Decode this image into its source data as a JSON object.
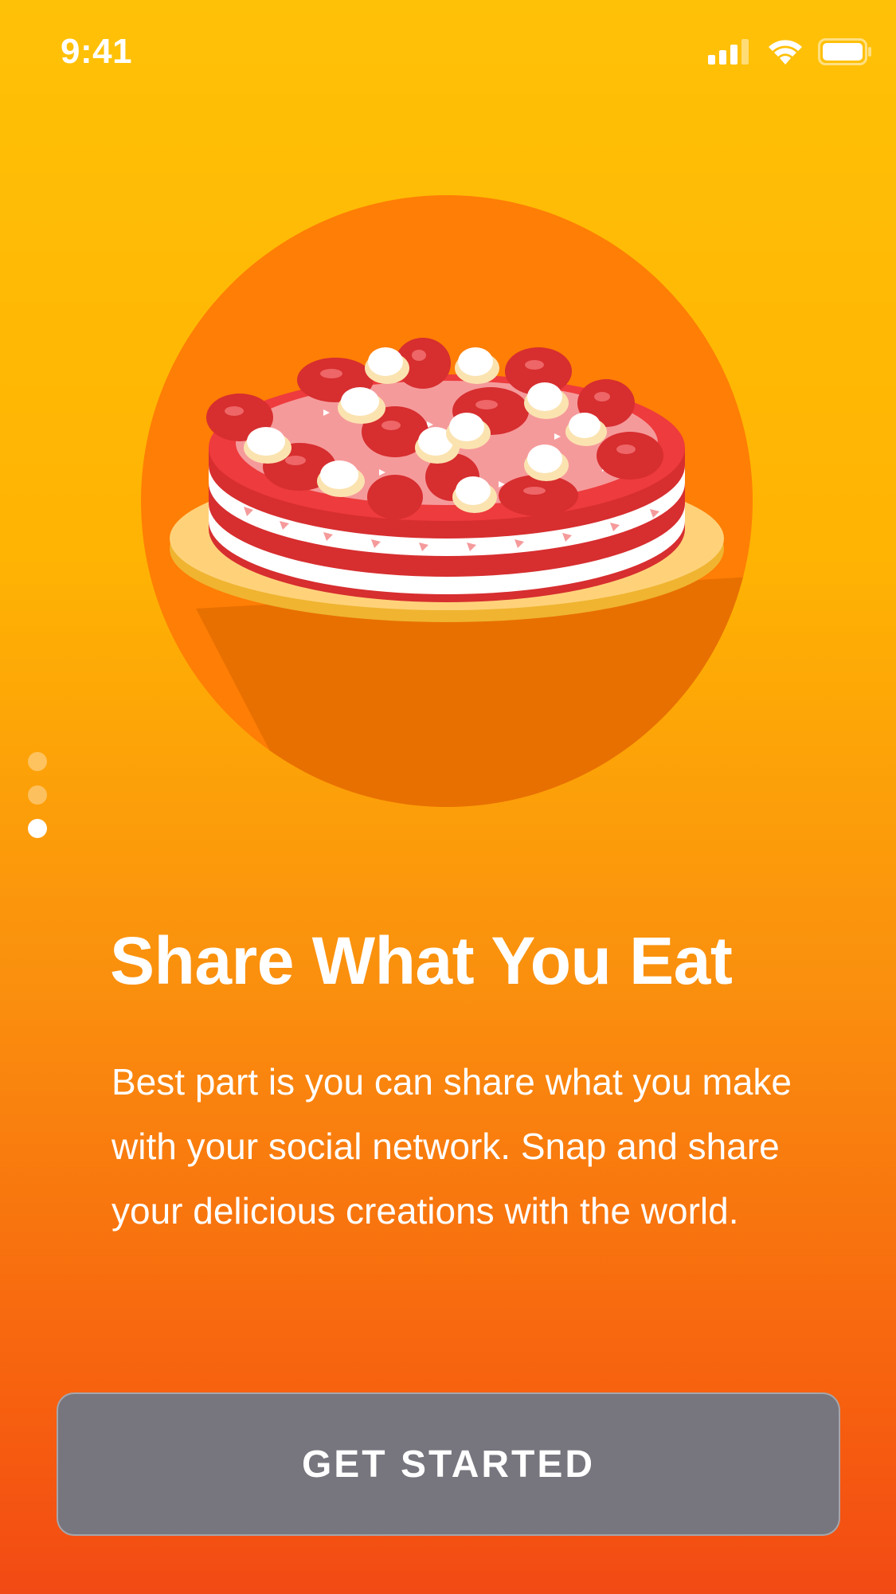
{
  "status_bar": {
    "time": "9:41",
    "icons": [
      "signal-icon",
      "wifi-icon",
      "battery-icon"
    ]
  },
  "hero": {
    "illustration": "strawberry-cake-illustration",
    "colors": {
      "circle": "#FF7E05",
      "shadow": "#E87000",
      "plate": "#FFD27A",
      "cake_red": "#D72E2F",
      "cream": "#FFFFFF",
      "frosting_pink": "#F59A9B"
    }
  },
  "pager": {
    "total": 3,
    "active_index": 2
  },
  "onboarding": {
    "title": "Share What You Eat",
    "description": "Best part is you can share what you make with your social network. Snap and share your delicious creations with the world."
  },
  "cta": {
    "label": "GET STARTED"
  },
  "theme": {
    "gradient_top": "#FFC107",
    "gradient_bottom": "#F24A14",
    "button_bg": "#77767E"
  }
}
